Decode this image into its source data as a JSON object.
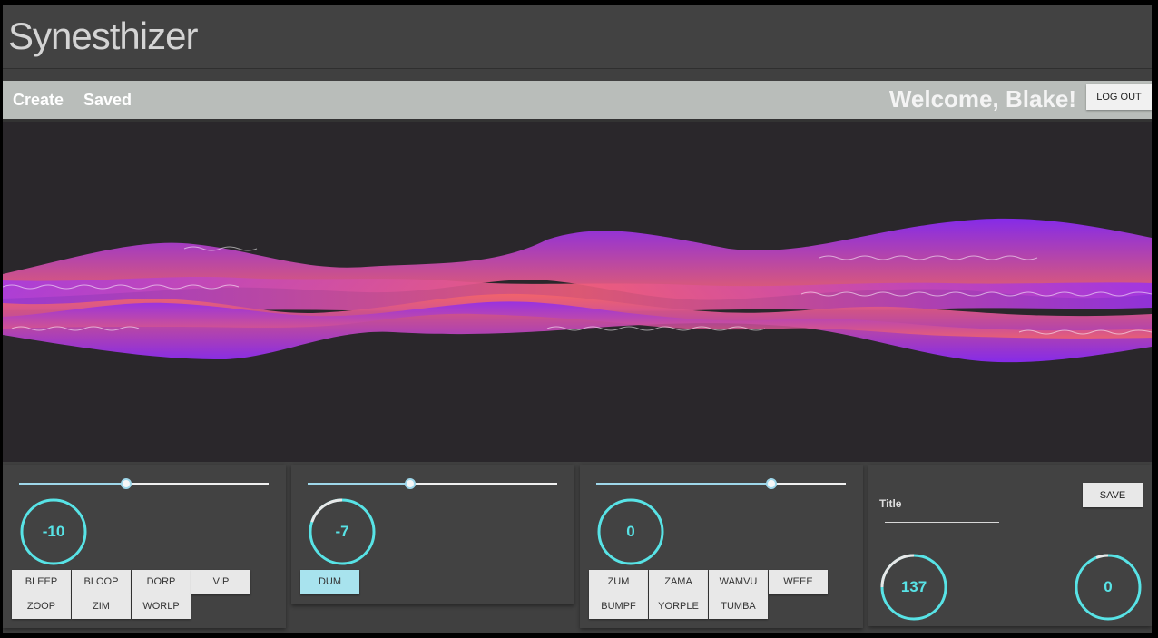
{
  "app": {
    "title": "Synesthizer"
  },
  "nav": {
    "create": "Create",
    "saved": "Saved",
    "welcome": "Welcome, Blake!",
    "logout": "LOG OUT"
  },
  "panels": [
    {
      "slider_fraction": 0.43,
      "knob_value": "-10",
      "knob_fraction": 0.0,
      "buttons": [
        "BLEEP",
        "BLOOP",
        "DORP",
        "VIP",
        "ZOOP",
        "ZIM",
        "WORLP"
      ],
      "active": []
    },
    {
      "slider_fraction": 0.41,
      "knob_value": "-7",
      "knob_fraction": 0.2,
      "buttons": [
        "DUM"
      ],
      "active": [
        "DUM"
      ]
    },
    {
      "slider_fraction": 0.7,
      "knob_value": "0",
      "knob_fraction": 0.0,
      "buttons": [
        "ZUM",
        "ZAMA",
        "WAMVU",
        "WEEE",
        "BUMPF",
        "YORPLE",
        "TUMBA"
      ],
      "active": []
    }
  ],
  "save_panel": {
    "title_label": "Title",
    "title_value": "",
    "save": "SAVE",
    "tempo_value": "137",
    "tempo_fraction": 0.25,
    "other_value": "0",
    "other_fraction": 0.06
  },
  "colors": {
    "accent": "#58e3e6",
    "slider": "#9fd7ea",
    "wave_purple": "#8a2bf2",
    "wave_coral": "#f2646a"
  }
}
